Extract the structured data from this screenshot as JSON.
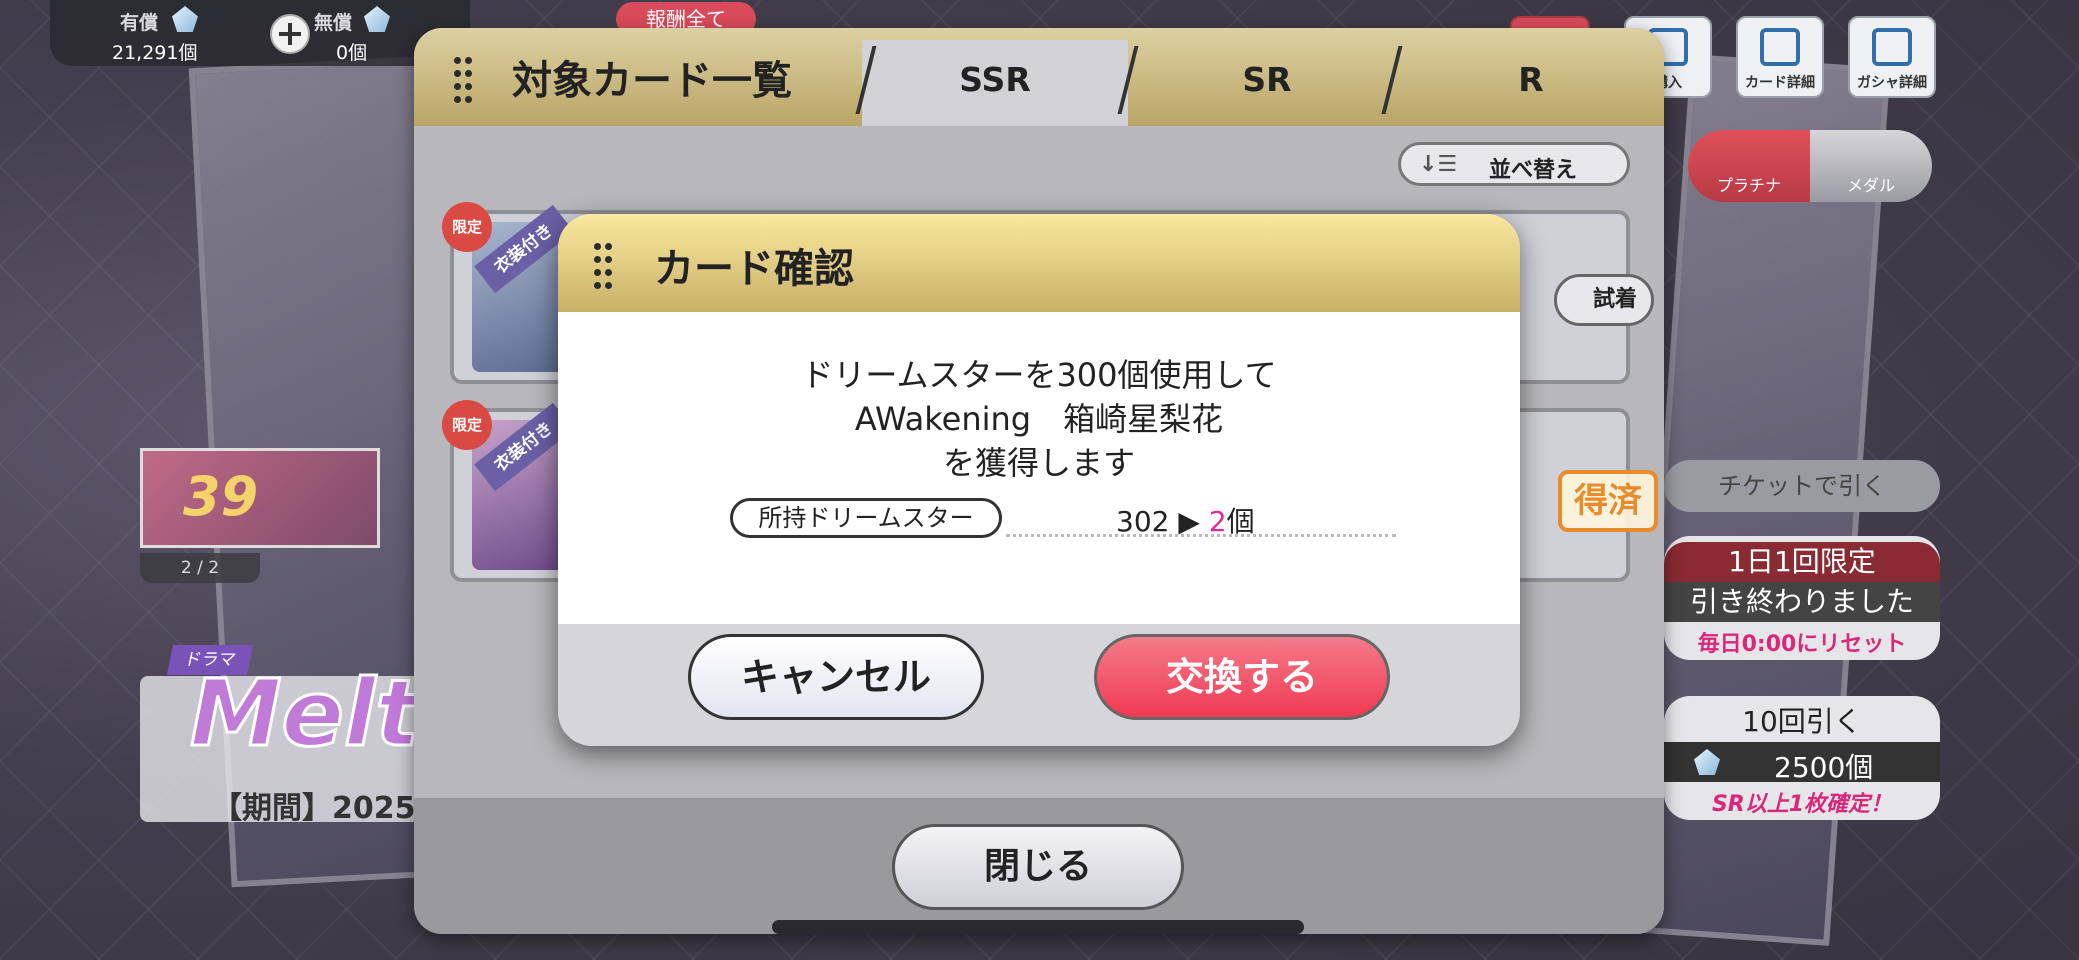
{
  "currency": {
    "paid_label": "有償",
    "paid_value": "21,291個",
    "free_label": "無償",
    "free_value": "0個"
  },
  "top_banner": {
    "reward_label": "報酬全て"
  },
  "top_right": {
    "buttons": [
      {
        "label": "購入",
        "icon": "shop-icon"
      },
      {
        "label": "カード詳細",
        "icon": "card-detail-icon"
      },
      {
        "label": "ガシャ詳細",
        "icon": "gacha-detail-icon"
      }
    ]
  },
  "gacha_tabs": {
    "platinum": "プラチナ",
    "medal": "メダル"
  },
  "right_panel": {
    "ticket_label": "チケットで引く",
    "daily_title": "1日1回限定",
    "daily_status": "引き終わりました",
    "daily_reset": "毎日0:00にリセット",
    "ten_pull_title": "10回引く",
    "ten_pull_cost": "2500個",
    "ten_pull_note": "SR以上1枚確定！"
  },
  "left_panel": {
    "event_number": "39",
    "event_count": "2 / 2",
    "drama_tag": "ドラマ",
    "event_title_fragment": "Melty",
    "period_fragment": "【期間】2025/6"
  },
  "card_list_modal": {
    "title": "対象カード一覧",
    "tabs": [
      "SSR",
      "SR",
      "R"
    ],
    "active_tab": "SSR",
    "sort_label": "並べ替え",
    "rows": [
      {
        "limited_badge": "限定",
        "costume_label": "衣装付き",
        "action_label": "試着"
      },
      {
        "limited_badge": "限定",
        "costume_label": "衣装付き",
        "status_label": "得済"
      }
    ],
    "close_label": "閉じる"
  },
  "confirm_dialog": {
    "title": "カード確認",
    "line1": "ドリームスターを300個使用して",
    "line2": "AWakening　箱崎星梨花",
    "line3": "を獲得します",
    "owned_label": "所持ドリームスター",
    "owned_before": "302",
    "arrow": "▶",
    "owned_after": "2",
    "unit": "個",
    "cancel_label": "キャンセル",
    "confirm_label": "交換する"
  },
  "colors": {
    "header_gold": "#c8b069",
    "confirm_red": "#f03a52",
    "count_highlight": "#e02a9a"
  }
}
